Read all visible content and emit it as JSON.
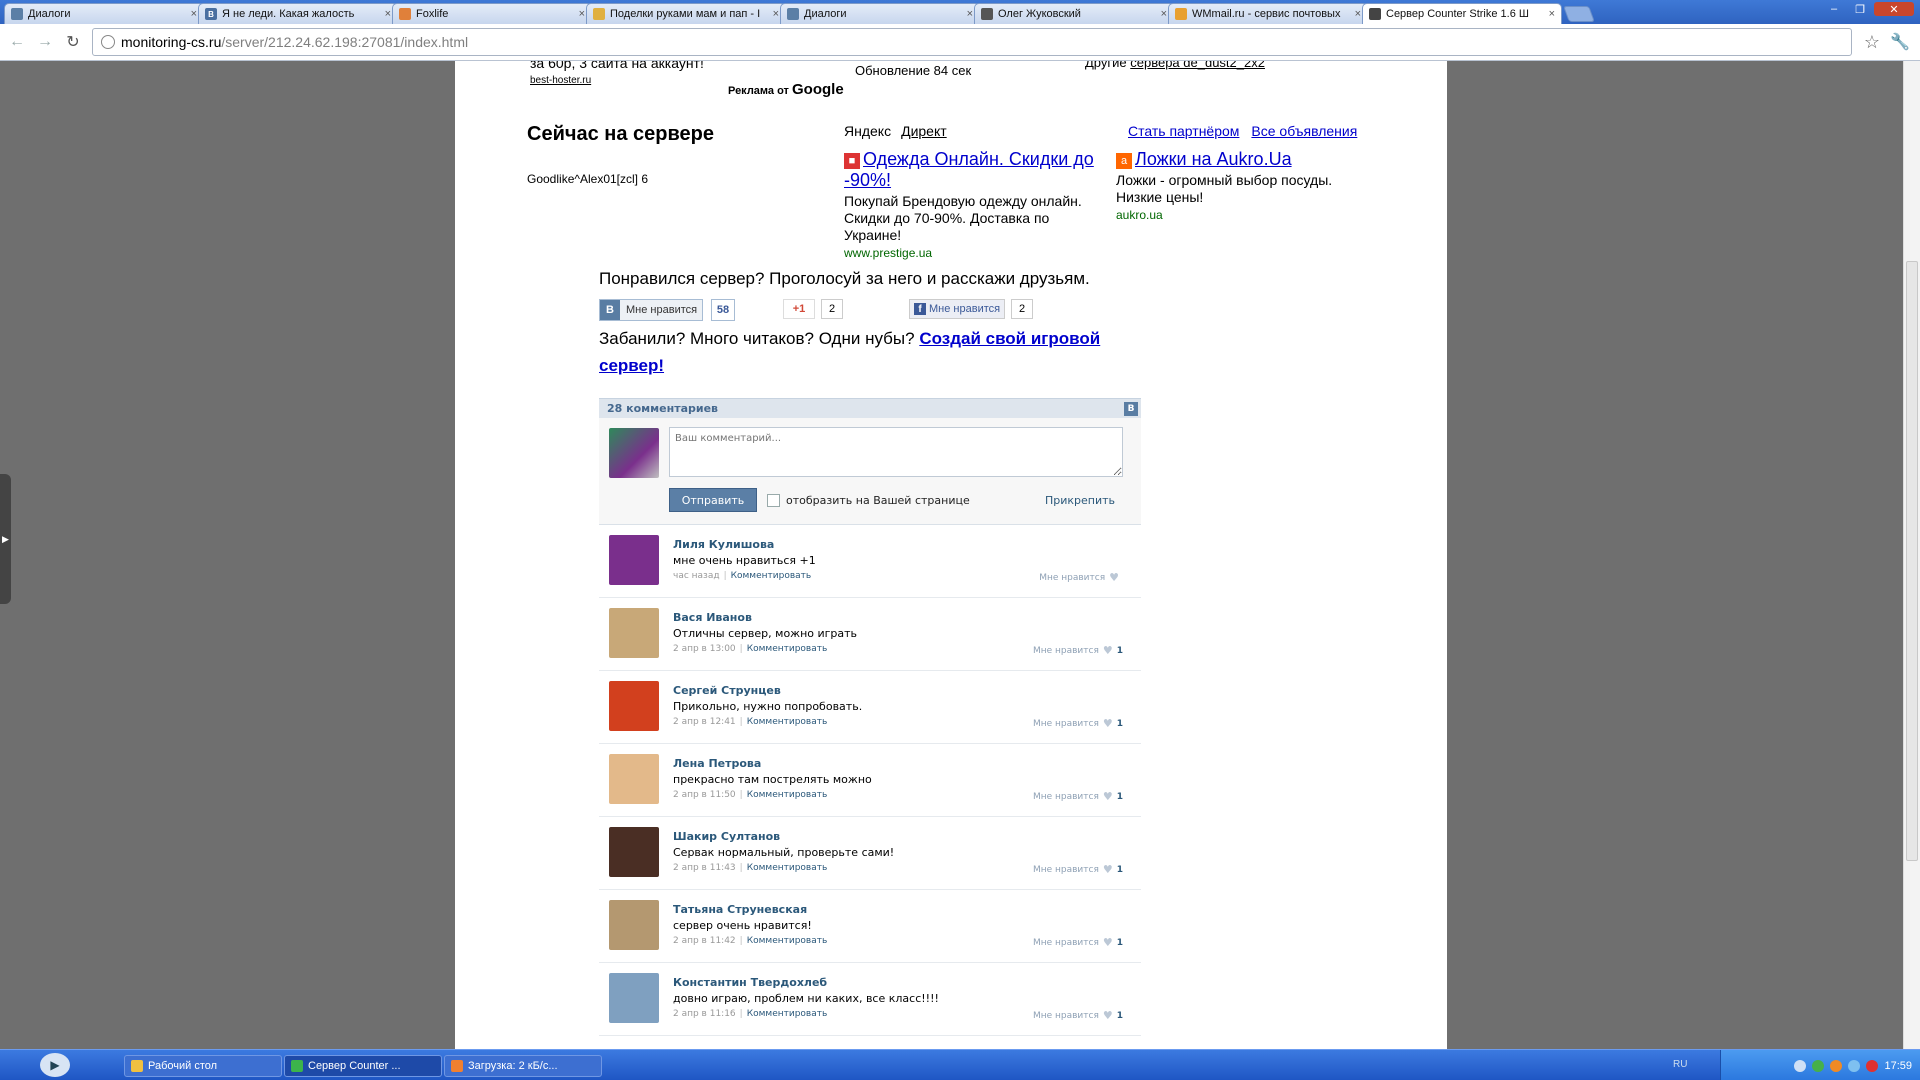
{
  "browser": {
    "tabs": [
      {
        "title": "Диалоги",
        "icon_color": "#5b7fa6",
        "icon_glyph": "speech-icon"
      },
      {
        "title": "Я не леди. Какая жалость",
        "icon_color": "#4a6fa0",
        "icon_glyph": "B"
      },
      {
        "title": "Foxlife",
        "icon_color": "#e0803a",
        "icon_glyph": "fox-icon"
      },
      {
        "title": "Поделки руками мам и пап - I",
        "icon_color": "#e0b040",
        "icon_glyph": "lamp-icon"
      },
      {
        "title": "Диалоги",
        "icon_color": "#5b7fa6",
        "icon_glyph": "speech-icon"
      },
      {
        "title": "Олег Жуковский",
        "icon_color": "#555555",
        "icon_glyph": "play-icon"
      },
      {
        "title": "WMmail.ru - сервис почтовых",
        "icon_color": "#e8a030",
        "icon_glyph": "mail-icon"
      },
      {
        "title": "Сервер Counter Strike 1.6 Ш",
        "icon_color": "#444444",
        "icon_glyph": "cs-icon"
      }
    ],
    "url_domain": "monitoring-cs.ru",
    "url_path": "/server/212.24.62.198:27081/index.html"
  },
  "page": {
    "top_ad": {
      "text": "за 60р, 3 сайта на аккаунт!",
      "link": "best-hoster.ru"
    },
    "google_ad_label": "Реклама от",
    "google_word": "Google",
    "update_text": "Обновление 84 сек",
    "other_text": "Другие",
    "other_link": "сервера de_dust2_2x2",
    "now_title": "Сейчас на сервере",
    "player": "Goodlike^Alex01[zcl] 6",
    "yandex": "Яндекс",
    "direct": "Директ",
    "become_partner": "Стать партнёром",
    "all_ads": "Все объявления",
    "ad1": {
      "title": "Одежда Онлайн. Скидки до -90%!",
      "text": "Покупай Брендовую одежду онлайн. Скидки до 70-90%. Доставка по Украине!",
      "url": "www.prestige.ua"
    },
    "ad2": {
      "title": "Ложки на Aukro.Ua",
      "text": "Ложки - огромный выбор посуды. Низкие цены!",
      "url": "aukro.ua"
    },
    "liked_text": "Понравился сервер? Проголосуй за него и расскажи друзьям.",
    "vk_like": "Мне нравится",
    "vk_count": "58",
    "g_plus": "+1",
    "g_count": "2",
    "fb_like": "Мне нравится",
    "fb_count": "2",
    "banned_text": "Забанили? Много читаков? Одни нубы?",
    "banned_link": "Создай свой игровой сервер!"
  },
  "comments": {
    "header": "28 комментариев",
    "placeholder": "Ваш комментарий...",
    "send": "Отправить",
    "show_on_page": "отобразить на Вашей странице",
    "attach": "Прикрепить",
    "reply": "Комментировать",
    "like_label": "Мне нравится",
    "items": [
      {
        "name": "Лиля Кулишова",
        "text": "мне очень нравиться +1",
        "time": "час назад",
        "likes": "",
        "avatar_color": "#7a2f8c"
      },
      {
        "name": "Вася Иванов",
        "text": "Отличны сервер, можно играть",
        "time": "2 апр в 13:00",
        "likes": "1",
        "avatar_color": "#c8a878"
      },
      {
        "name": "Сергей Струнцев",
        "text": "Прикольно, нужно попробовать.",
        "time": "2 апр в 12:41",
        "likes": "1",
        "avatar_color": "#d2401e"
      },
      {
        "name": "Лена Петрова",
        "text": "прекрасно там пострелять можно",
        "time": "2 апр в 11:50",
        "likes": "1",
        "avatar_color": "#e3b98a"
      },
      {
        "name": "Шакир Султанов",
        "text": "Сервак нормальный, проверьте сами!",
        "time": "2 апр в 11:43",
        "likes": "1",
        "avatar_color": "#4a2e24"
      },
      {
        "name": "Татьяна Струневская",
        "text": "сервер очень нравится!",
        "time": "2 апр в 11:42",
        "likes": "1",
        "avatar_color": "#b49870"
      },
      {
        "name": "Константин Твердохлеб",
        "text": "довно играю, проблем ни каких, все класс!!!!",
        "time": "2 апр в 11:16",
        "likes": "1",
        "avatar_color": "#7fa0c0"
      }
    ]
  },
  "taskbar": {
    "items": [
      {
        "label": "Рабочий стол",
        "icon_color": "#f0c040"
      },
      {
        "label": "Сервер Counter ...",
        "icon_color": "#3cb44b"
      },
      {
        "label": "Загрузка: 2 кБ/с...",
        "icon_color": "#f08030"
      }
    ],
    "lang": "RU",
    "clock": "17:59"
  }
}
